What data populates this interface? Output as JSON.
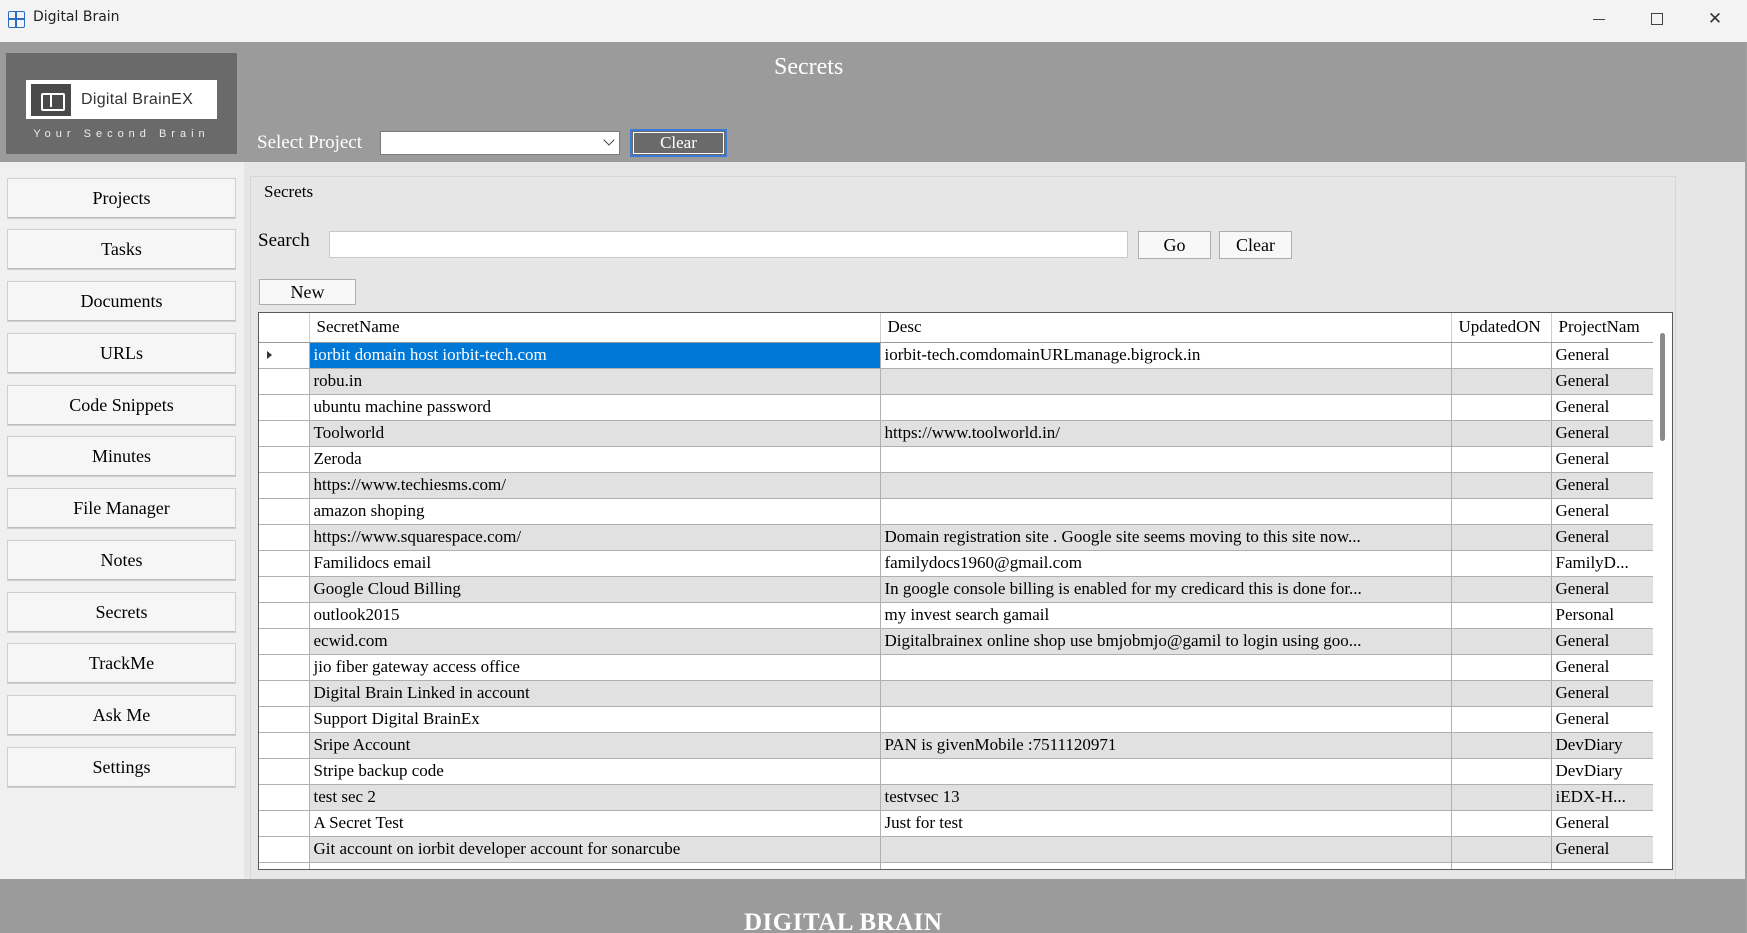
{
  "window": {
    "title": "Digital Brain"
  },
  "header": {
    "logo_text": "Digital BrainEX",
    "logo_tagline": "Your Second Brain",
    "page_title": "Secrets",
    "select_label": "Select Project",
    "select_value": "",
    "clear_label": "Clear"
  },
  "sidebar": {
    "items": [
      {
        "label": "Projects"
      },
      {
        "label": "Tasks"
      },
      {
        "label": "Documents"
      },
      {
        "label": "URLs"
      },
      {
        "label": "Code Snippets"
      },
      {
        "label": "Minutes"
      },
      {
        "label": "File Manager"
      },
      {
        "label": "Notes"
      },
      {
        "label": "Secrets"
      },
      {
        "label": "TrackMe"
      },
      {
        "label": "Ask Me"
      },
      {
        "label": "Settings"
      }
    ]
  },
  "main": {
    "group_title": "Secrets",
    "search_label": "Search",
    "search_value": "",
    "go_label": "Go",
    "clear_label": "Clear",
    "new_label": "New",
    "grid": {
      "columns": [
        "SecretName",
        "Desc",
        "UpdatedON",
        "ProjectNam"
      ],
      "rows": [
        {
          "name": "iorbit domain host iorbit-tech.com",
          "desc": "iorbit-tech.comdomainURLmanage.bigrock.in",
          "updated": "",
          "project": "General"
        },
        {
          "name": "robu.in",
          "desc": "",
          "updated": "",
          "project": "General"
        },
        {
          "name": "ubuntu machine password",
          "desc": "",
          "updated": "",
          "project": "General"
        },
        {
          "name": "Toolworld",
          "desc": "https://www.toolworld.in/",
          "updated": "",
          "project": "General"
        },
        {
          "name": "Zeroda",
          "desc": "",
          "updated": "",
          "project": "General"
        },
        {
          "name": "https://www.techiesms.com/",
          "desc": "",
          "updated": "",
          "project": "General"
        },
        {
          "name": "amazon shoping",
          "desc": "",
          "updated": "",
          "project": "General"
        },
        {
          "name": "https://www.squarespace.com/",
          "desc": "Domain registration site . Google site seems moving to this site now...",
          "updated": "",
          "project": "General"
        },
        {
          "name": "Familidocs email",
          "desc": "familydocs1960@gmail.com",
          "updated": "",
          "project": "FamilyD..."
        },
        {
          "name": "Google Cloud Billing",
          "desc": "In google console billing is enabled for my credicard this is done for...",
          "updated": "",
          "project": "General"
        },
        {
          "name": "outlook2015",
          "desc": "my invest search gamail",
          "updated": "",
          "project": "Personal"
        },
        {
          "name": "ecwid.com",
          "desc": "Digitalbrainex online shop use bmjobmjo@gamil to login using goo...",
          "updated": "",
          "project": "General"
        },
        {
          "name": "jio fiber gateway access office",
          "desc": "",
          "updated": "",
          "project": "General"
        },
        {
          "name": "Digital Brain Linked in account",
          "desc": "",
          "updated": "",
          "project": "General"
        },
        {
          "name": "Support Digital BrainEx",
          "desc": "",
          "updated": "",
          "project": "General"
        },
        {
          "name": "Sripe Account",
          "desc": "PAN is givenMobile :7511120971",
          "updated": "",
          "project": "DevDiary"
        },
        {
          "name": "Stripe backup code",
          "desc": "",
          "updated": "",
          "project": "DevDiary"
        },
        {
          "name": "test sec 2",
          "desc": "testvsec 13",
          "updated": "",
          "project": "iEDX-H..."
        },
        {
          "name": "A Secret Test",
          "desc": "Just for test",
          "updated": "",
          "project": "General"
        },
        {
          "name": "Git account on iorbit developer account for sonarcube",
          "desc": "",
          "updated": "",
          "project": "General"
        },
        {
          "name": "",
          "desc": "",
          "updated": "",
          "project": ""
        }
      ]
    }
  },
  "footer": {
    "text": "DIGITAL BRAIN"
  },
  "colors": {
    "header_bg": "#9b9b9b",
    "selection": "#0078d7",
    "alt_row": "#e1e1e1"
  }
}
